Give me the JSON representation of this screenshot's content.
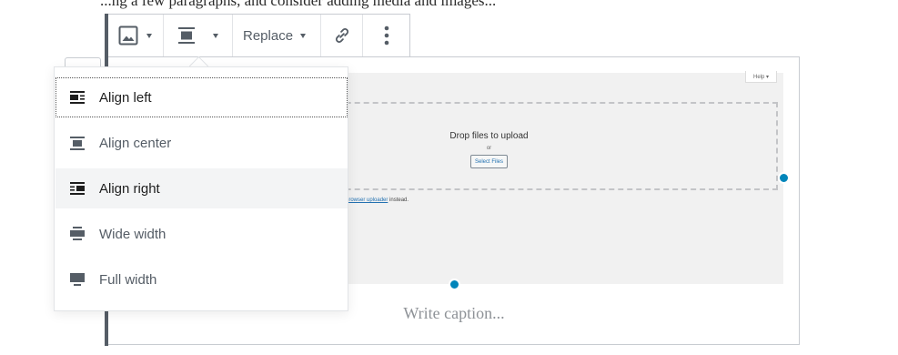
{
  "top_text": "...ng a few paragraphs, and consider adding media and images...",
  "toolbar": {
    "image_type_icon": "image-icon",
    "align_icon": "align-center-icon",
    "replace_label": "Replace",
    "link_icon": "link-icon",
    "more_icon": "more-vertical-icon"
  },
  "upload": {
    "help_label": "Help ▾",
    "drop_title": "Drop files to upload",
    "or_label": "or",
    "select_button": "Select Files",
    "note_link": "browser uploader",
    "note_suffix": " instead."
  },
  "caption_placeholder": "Write caption...",
  "align_menu": {
    "items": [
      {
        "label": "Align left",
        "icon": "align-left-icon",
        "state": "focused"
      },
      {
        "label": "Align center",
        "icon": "align-center-icon",
        "state": "normal"
      },
      {
        "label": "Align right",
        "icon": "align-right-icon",
        "state": "hover"
      },
      {
        "label": "Wide width",
        "icon": "align-wide-icon",
        "state": "normal"
      },
      {
        "label": "Full width",
        "icon": "align-full-icon",
        "state": "normal"
      }
    ]
  },
  "colors": {
    "accent": "#0085ba",
    "icon": "#555d66",
    "border": "#c8ccd1",
    "placeholder_bg": "#f1f1f1"
  }
}
